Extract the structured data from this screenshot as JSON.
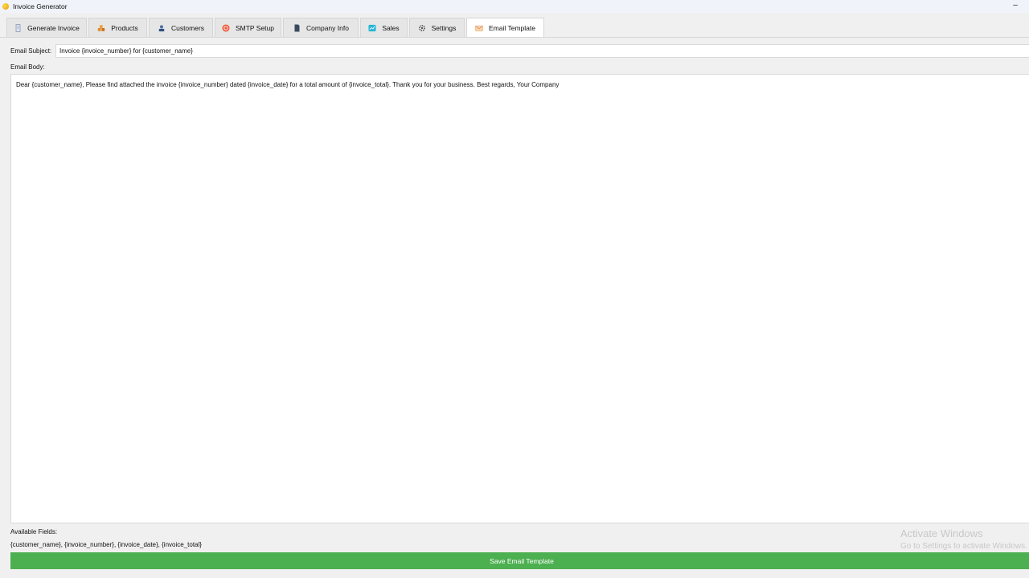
{
  "window": {
    "title": "Invoice Generator",
    "minimize_label": "–"
  },
  "tabs": [
    {
      "label": "Generate Invoice",
      "icon": "invoice-icon"
    },
    {
      "label": "Products",
      "icon": "products-icon"
    },
    {
      "label": "Customers",
      "icon": "customers-icon"
    },
    {
      "label": "SMTP Setup",
      "icon": "smtp-icon"
    },
    {
      "label": "Company Info",
      "icon": "company-icon"
    },
    {
      "label": "Sales",
      "icon": "sales-icon"
    },
    {
      "label": "Settings",
      "icon": "settings-icon"
    },
    {
      "label": "Email Template",
      "icon": "email-template-icon"
    }
  ],
  "active_tab": "Email Template",
  "form": {
    "subject_label": "Email Subject:",
    "subject_value": "Invoice {invoice_number} for {customer_name}",
    "body_label": "Email Body:",
    "body_value": "Dear {customer_name}, Please find attached the invoice {invoice_number} dated {invoice_date} for a total amount of {invoice_total}. Thank you for your business. Best regards, Your Company",
    "fields_label": "Available Fields:",
    "fields_value": "{customer_name}, {invoice_number}, {invoice_date}, {invoice_total}",
    "save_label": "Save Email Template"
  },
  "watermark": {
    "title": "Activate Windows",
    "subtitle": "Go to Settings to activate Windows."
  },
  "colors": {
    "save_button": "#4caf50",
    "smtp_icon": "#ef5a3c",
    "sales_icon": "#29b6d6"
  }
}
